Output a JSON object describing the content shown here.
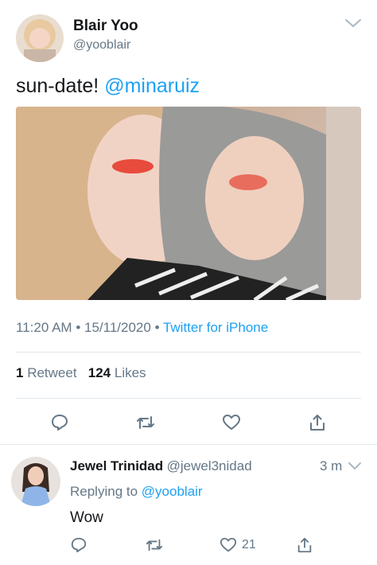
{
  "tweet": {
    "author": {
      "name": "Blair Yoo",
      "handle": "@yooblair"
    },
    "text": "sun-date!",
    "mention": "@minaruiz",
    "time": "11:20 AM",
    "date": "15/11/2020",
    "source": "Twitter for iPhone",
    "retweet_count": "1",
    "retweet_label": "Retweet",
    "like_count": "124",
    "like_label": "Likes"
  },
  "reply": {
    "author": {
      "name": "Jewel Trinidad",
      "handle": "@jewel3nidad"
    },
    "time": "3 m",
    "replying_to_label": "Replying to",
    "replying_to_handle": "@yooblair",
    "text": "Wow",
    "like_count": "21"
  },
  "colors": {
    "accent": "#1da1f2",
    "secondary_text": "#657786",
    "divider": "#e1e8ed"
  }
}
